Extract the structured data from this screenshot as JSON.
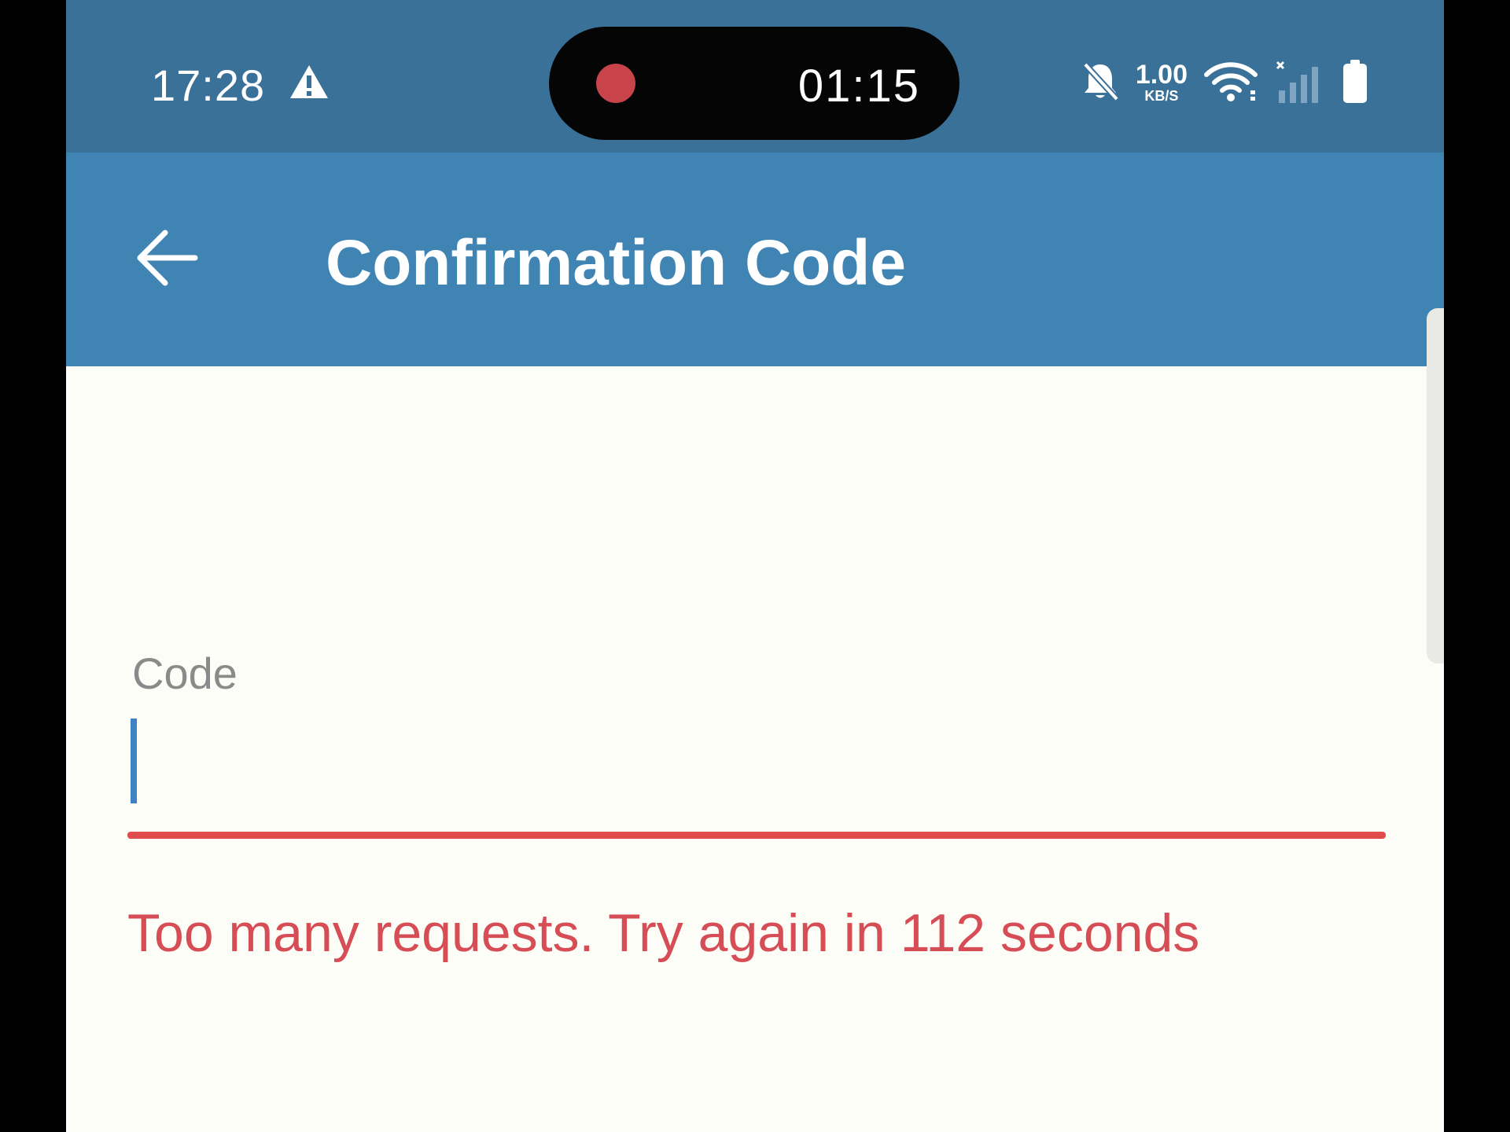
{
  "status_bar": {
    "time": "17:28",
    "icons": {
      "alert": "warning-triangle-icon",
      "mute": "bell-off-icon",
      "wifi": "wifi-icon",
      "signal": "cellular-signal-off-icon",
      "battery": "battery-full-icon"
    },
    "net_speed_value": "1.00",
    "net_speed_unit": "KB/S"
  },
  "screen_recorder": {
    "timer": "01:15",
    "indicator_color": "#c8444a"
  },
  "app_bar": {
    "title": "Confirmation Code",
    "back_icon": "arrow-left-icon",
    "color": "#4084b4"
  },
  "form": {
    "code_label": "Code",
    "code_value": "",
    "error_message": "Too many requests. Try again in 112 seconds",
    "error_color": "#e04b4b"
  },
  "colors": {
    "status_bar": "#3a7199",
    "background": "#fdfdf8",
    "caret": "#3f83c2"
  }
}
